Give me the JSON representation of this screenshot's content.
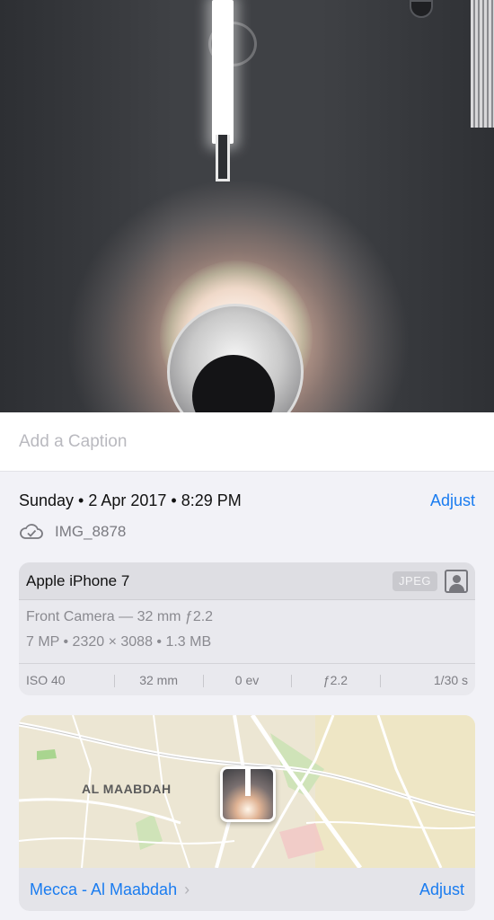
{
  "caption": {
    "placeholder": "Add a Caption"
  },
  "info": {
    "date": "Sunday • 2 Apr 2017 • 8:29 PM",
    "adjust_label": "Adjust",
    "file_name": "IMG_8878",
    "cloud_icon": "cloud-check-icon"
  },
  "device": {
    "name": "Apple iPhone 7",
    "format_badge": "JPEG",
    "portrait_icon": "portrait-icon",
    "camera": "Front Camera — 32 mm ƒ2.2",
    "specs": "7 MP • 2320 × 3088 • 1.3 MB",
    "exif": [
      "ISO 40",
      "32 mm",
      "0 ev",
      "ƒ2.2",
      "1/30 s"
    ]
  },
  "map": {
    "area_label": "AL MAABDAH",
    "location": "Mecca - Al Maabdah",
    "adjust_label": "Adjust"
  },
  "colors": {
    "accent": "#1a7cf0",
    "background": "#f2f2f7"
  }
}
